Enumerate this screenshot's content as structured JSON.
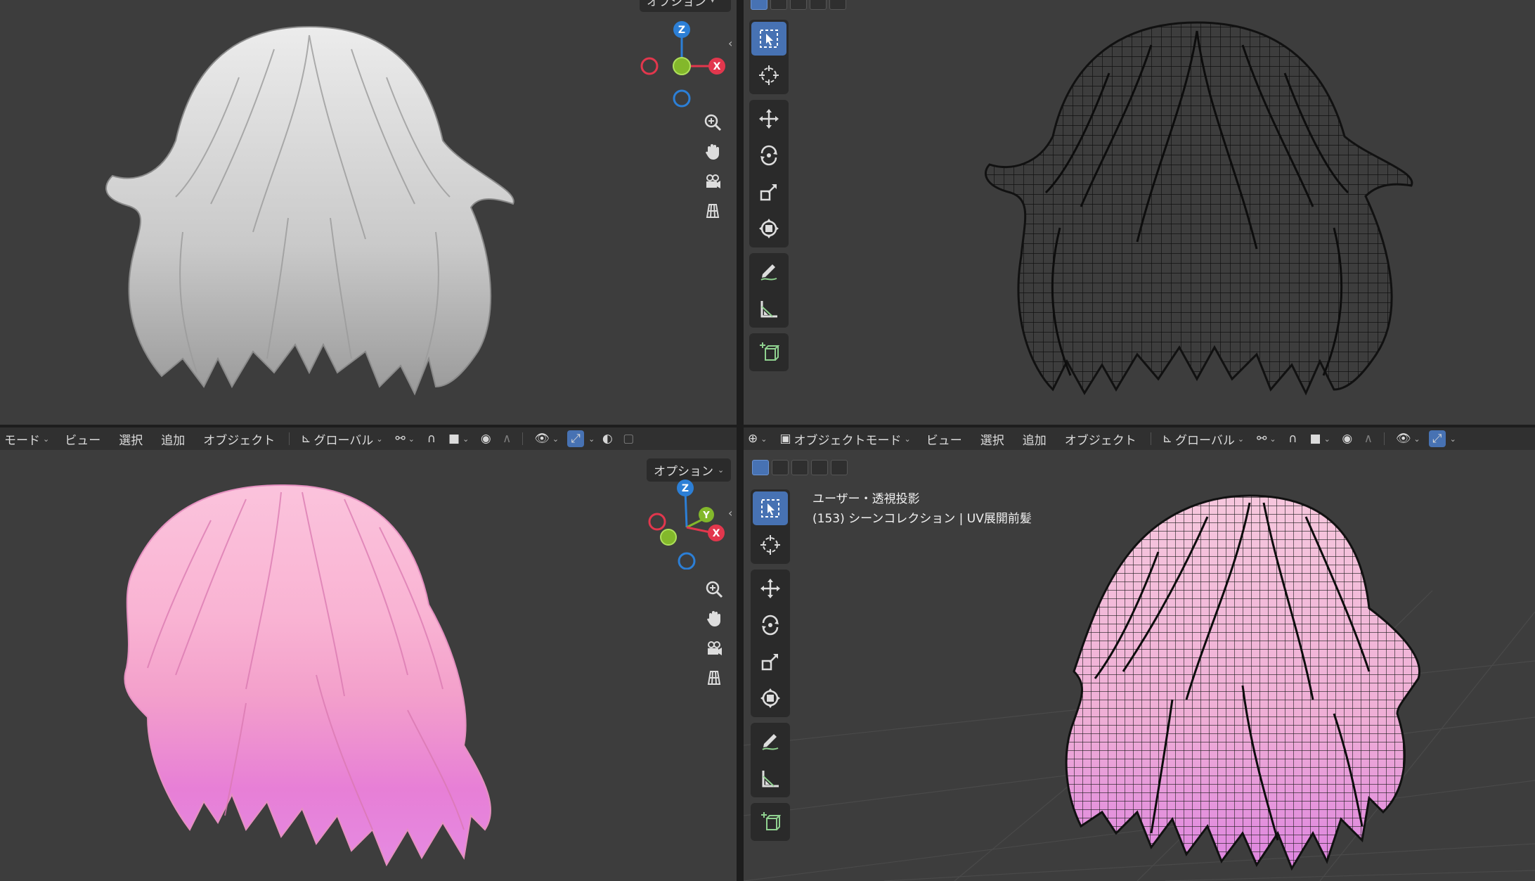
{
  "header_left": {
    "mode_label": "モード",
    "menus": [
      "ビュー",
      "選択",
      "追加",
      "オブジェクト"
    ],
    "transform_orientation": "グローバル"
  },
  "header_right": {
    "mode_label": "オブジェクトモード",
    "menus": [
      "ビュー",
      "選択",
      "追加",
      "オブジェクト"
    ],
    "transform_orientation": "グローバル"
  },
  "options_label": "オプション",
  "gizmo_axes": {
    "x": "X",
    "y": "Y",
    "z": "Z"
  },
  "viewport_overlay": {
    "view_name": "ユーザー・透視投影",
    "collection_info": "(153) シーンコレクション | UV展開前髪"
  },
  "colors": {
    "viewport_bg": "#3d3d3d",
    "header_bg": "#303030",
    "active_blue": "#4772b3",
    "axis_x": "#e2374d",
    "axis_y": "#83b82b",
    "axis_z": "#2c7fd6",
    "hair_white": "#e6e6e6",
    "hair_pink": "#f6a5cd"
  },
  "icons": [
    "cursor-select-icon",
    "3d-cursor-icon",
    "move-icon",
    "rotate-icon",
    "scale-icon",
    "transform-icon",
    "annotate-icon",
    "measure-icon",
    "add-cube-icon",
    "zoom-icon",
    "hand-pan-icon",
    "camera-icon",
    "grid-ortho-icon"
  ]
}
